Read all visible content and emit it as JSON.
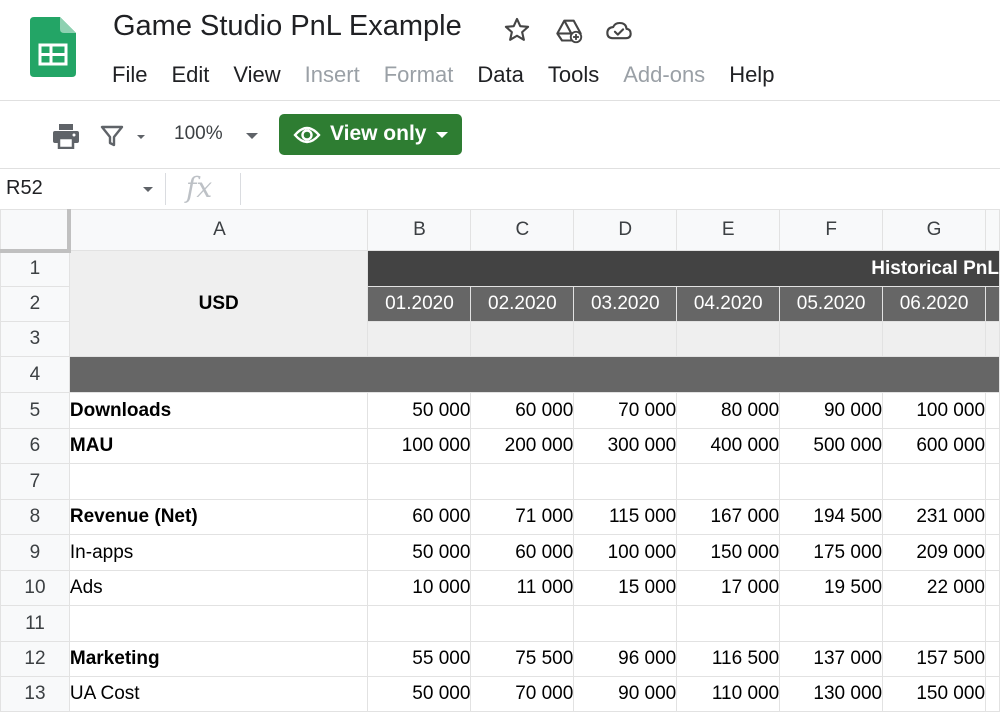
{
  "window": {
    "doc_title": "Game Studio PnL Example",
    "menu": [
      {
        "label": "File",
        "enabled": true
      },
      {
        "label": "Edit",
        "enabled": true
      },
      {
        "label": "View",
        "enabled": true
      },
      {
        "label": "Insert",
        "enabled": false
      },
      {
        "label": "Format",
        "enabled": false
      },
      {
        "label": "Data",
        "enabled": true
      },
      {
        "label": "Tools",
        "enabled": true
      },
      {
        "label": "Add-ons",
        "enabled": false
      },
      {
        "label": "Help",
        "enabled": true
      }
    ]
  },
  "toolbar": {
    "zoom": "100%",
    "view_only_label": "View only",
    "accent_color": "#2e7d32"
  },
  "formula_bar": {
    "cell_ref": "R52",
    "fx_symbol": "fx",
    "content": ""
  },
  "sheet": {
    "column_headers": [
      "A",
      "B",
      "C",
      "D",
      "E",
      "F",
      "G"
    ],
    "row_numbers": [
      "1",
      "2",
      "3",
      "4",
      "5",
      "6",
      "7",
      "8",
      "9",
      "10",
      "11",
      "12",
      "13"
    ],
    "header_label": "USD",
    "section_title": "Historical PnL",
    "months": [
      "01.2020",
      "02.2020",
      "03.2020",
      "04.2020",
      "05.2020",
      "06.2020"
    ],
    "data_rows": [
      {
        "label": "Downloads",
        "bold": true,
        "values": [
          "50 000",
          "60 000",
          "70 000",
          "80 000",
          "90 000",
          "100 000"
        ]
      },
      {
        "label": "MAU",
        "bold": true,
        "values": [
          "100 000",
          "200 000",
          "300 000",
          "400 000",
          "500 000",
          "600 000"
        ]
      },
      {
        "label": "",
        "bold": false,
        "values": [
          "",
          "",
          "",
          "",
          "",
          ""
        ]
      },
      {
        "label": "Revenue (Net)",
        "bold": true,
        "values": [
          "60 000",
          "71 000",
          "115 000",
          "167 000",
          "194 500",
          "231 000"
        ]
      },
      {
        "label": "In-apps",
        "bold": false,
        "values": [
          "50 000",
          "60 000",
          "100 000",
          "150 000",
          "175 000",
          "209 000"
        ]
      },
      {
        "label": "Ads",
        "bold": false,
        "values": [
          "10 000",
          "11 000",
          "15 000",
          "17 000",
          "19 500",
          "22 000"
        ]
      },
      {
        "label": "",
        "bold": false,
        "values": [
          "",
          "",
          "",
          "",
          "",
          ""
        ]
      },
      {
        "label": "Marketing",
        "bold": true,
        "values": [
          "55 000",
          "75 500",
          "96 000",
          "116 500",
          "137 000",
          "157 500"
        ]
      },
      {
        "label": "UA Cost",
        "bold": false,
        "values": [
          "50 000",
          "70 000",
          "90 000",
          "110 000",
          "130 000",
          "150 000"
        ]
      }
    ]
  }
}
